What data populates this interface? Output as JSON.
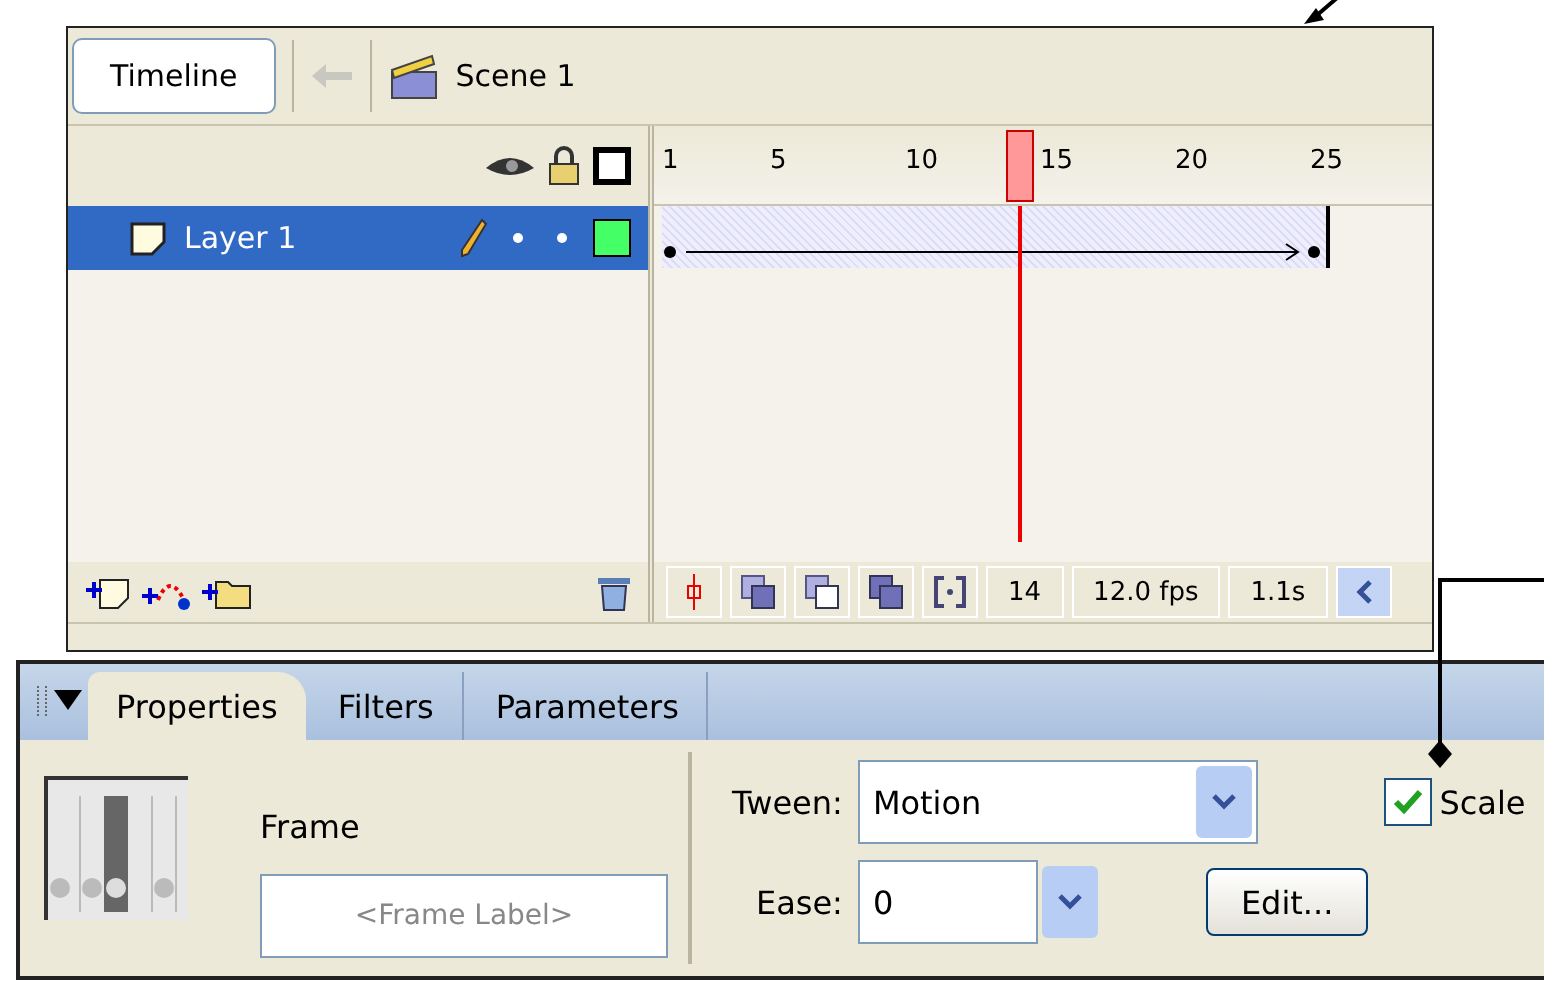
{
  "timeline": {
    "button": "Timeline",
    "scene": "Scene 1",
    "ruler": [
      "1",
      "5",
      "10",
      "15",
      "20",
      "25"
    ],
    "playhead": {
      "level": 0.47
    },
    "layers": [
      {
        "name": "Layer 1",
        "selected": true
      }
    ],
    "status": {
      "frame": "14",
      "rate": "12.0 fps",
      "time": "1.1s"
    }
  },
  "properties": {
    "tabs": [
      {
        "label": "Properties",
        "selected": true
      },
      {
        "label": "Filters",
        "selected": false
      },
      {
        "label": "Parameters",
        "selected": false
      }
    ],
    "frame_title": "Frame",
    "frame_label": {
      "placeholder": "<Frame Label>"
    },
    "tween_label": "Tween:",
    "tween": "Motion",
    "scale": {
      "label": "Scale",
      "checked": true
    },
    "ease_label": "Ease:",
    "ease": "0",
    "edit_button": "Edit..."
  }
}
